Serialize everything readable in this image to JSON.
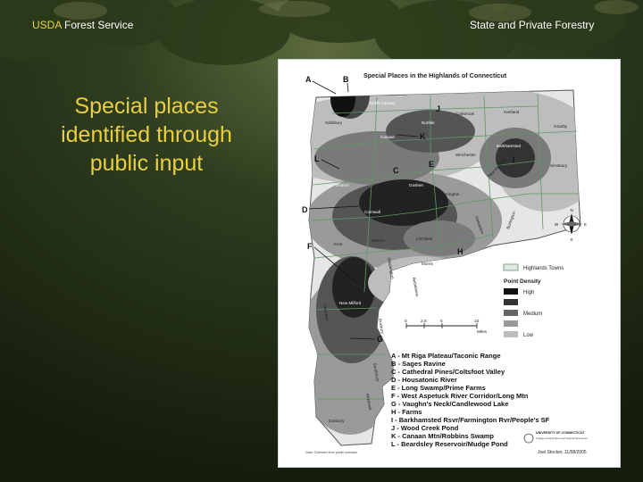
{
  "header": {
    "org_prefix": "USDA",
    "org_suffix": " Forest Service",
    "right": "State and Private Forestry"
  },
  "slide_title": {
    "line1": "Special places",
    "line2": "identified through",
    "line3": "public input"
  },
  "map": {
    "title": "Special Places in the Highlands of Connecticut",
    "callouts": [
      "A",
      "B",
      "C",
      "D",
      "E",
      "F",
      "G",
      "H",
      "I",
      "J",
      "K",
      "L"
    ],
    "towns": [
      "North Canaan",
      "Colebrook",
      "Hartland",
      "Salisbury",
      "Norfolk",
      "Granby",
      "Canaan",
      "Winchester",
      "Barkhamsted",
      "Simsbury",
      "Sharon",
      "Goshen",
      "Torrington",
      "Cornwall",
      "Kent",
      "Warren",
      "Litchfield",
      "Morris",
      "New Hartford",
      "Harwinton",
      "Burlington",
      "Washington",
      "New Milford",
      "Sherman",
      "Roxbury",
      "Bethlehem",
      "Southbury",
      "Newtown",
      "Danbury"
    ],
    "legend": {
      "highlands_towns": "Highlands Towns",
      "point_density": "Point Density",
      "high": "High",
      "medium": "Medium",
      "low": "Low"
    },
    "scale": {
      "ticks": [
        "0",
        "2.5",
        "5",
        "10"
      ],
      "unit": "Miles"
    },
    "compass": {
      "n": "N",
      "s": "S",
      "e": "E",
      "w": "W"
    },
    "places": [
      "A - Mt Riga Plateau/Taconic Range",
      "B - Sages Ravine",
      "C - Cathedral Pines/Coltsfoot Valley",
      "D - Housatonic River",
      "E - Long Swamp/Prime Farms",
      "F - West Aspetuck River Corridor/Long Mtn",
      "G - Vaughn's Neck/Candlewood Lake",
      "H - Farms",
      "I - Barkhamsted Rsvr/Farmington Rvr/People's SF",
      "J - Wood Creek Pond",
      "K - Canaan Mtn/Robbins Swamp",
      "L - Beardsley Reservoir/Mudge Pond"
    ],
    "credit": "Joel Stocker, 11/08/2005",
    "logo_text": "UNIVERSITY OF CONNECTICUT",
    "logo_sub": "College of Agriculture and Natural Resources",
    "note": "Data: Collected from public outreach",
    "density_colors": {
      "high": "#111111",
      "medium_dark": "#444444",
      "medium": "#7a7a7a",
      "low": "#bdbdbd",
      "base": "#e6e6e6"
    }
  }
}
